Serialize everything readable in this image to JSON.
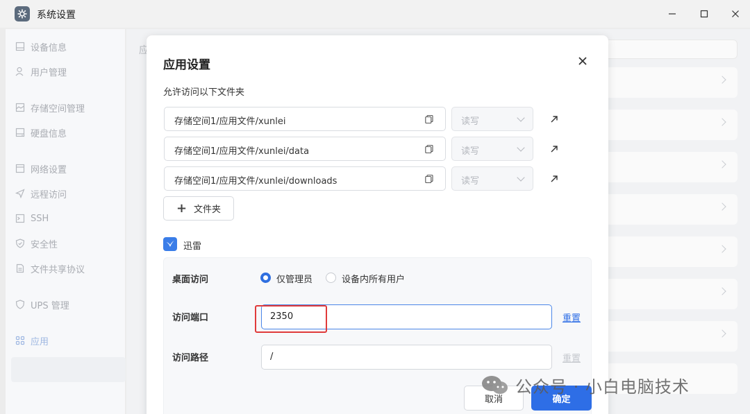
{
  "window": {
    "title": "系统设置"
  },
  "sidebar": {
    "items": [
      {
        "label": "设备信息",
        "icon": "device-icon"
      },
      {
        "label": "用户管理",
        "icon": "user-icon"
      },
      {
        "label": "存储空间管理",
        "icon": "storage-icon"
      },
      {
        "label": "硬盘信息",
        "icon": "disk-icon"
      },
      {
        "label": "网络设置",
        "icon": "network-icon"
      },
      {
        "label": "远程访问",
        "icon": "remote-icon"
      },
      {
        "label": "SSH",
        "icon": "terminal-icon"
      },
      {
        "label": "安全性",
        "icon": "shield-icon"
      },
      {
        "label": "文件共享协议",
        "icon": "file-icon"
      },
      {
        "label": "UPS 管理",
        "icon": "ups-icon"
      },
      {
        "label": "应用",
        "icon": "apps-icon",
        "active": true
      }
    ]
  },
  "background": {
    "heading_fragment": "应"
  },
  "dialog": {
    "title": "应用设置",
    "folders_label": "允许访问以下文件夹",
    "folders": [
      {
        "path": "存储空间1/应用文件/xunlei",
        "permission": "读写"
      },
      {
        "path": "存储空间1/应用文件/xunlei/data",
        "permission": "读写"
      },
      {
        "path": "存储空间1/应用文件/xunlei/downloads",
        "permission": "读写"
      }
    ],
    "add_folder_label": "文件夹",
    "app_name": "迅雷",
    "desktop_access": {
      "label": "桌面访问",
      "options": [
        "仅管理员",
        "设备内所有用户"
      ],
      "selected": "仅管理员"
    },
    "port": {
      "label": "访问端口",
      "value": "2350",
      "reset_label": "重置"
    },
    "path": {
      "label": "访问路径",
      "value": "/",
      "reset_label": "重置"
    },
    "cancel_label": "取消",
    "ok_label": "确定"
  },
  "watermark": {
    "text": "公众号 · 小白电脑技术"
  },
  "colors": {
    "accent": "#2e6ee6",
    "highlight": "#e03a3a",
    "link": "#2e6ee6",
    "link_disabled": "#c5c8cd"
  }
}
